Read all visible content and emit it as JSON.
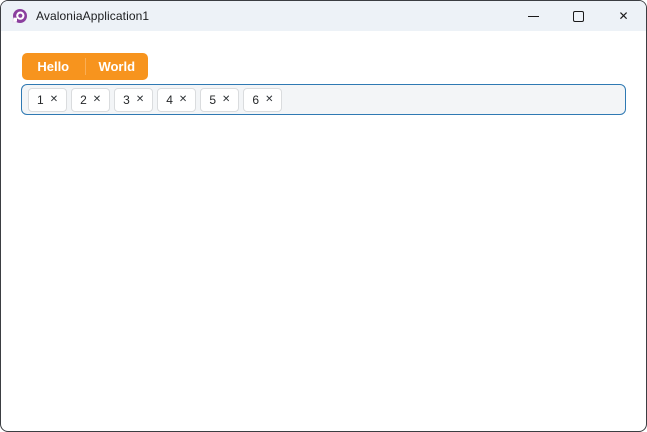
{
  "window": {
    "title": "AvaloniaApplication1",
    "controls": {
      "close_glyph": "✕"
    }
  },
  "tabs": {
    "items": [
      {
        "label": "Hello"
      },
      {
        "label": "World"
      }
    ]
  },
  "tags_input": {
    "items": [
      {
        "value": "1"
      },
      {
        "value": "2"
      },
      {
        "value": "3"
      },
      {
        "value": "4"
      },
      {
        "value": "5"
      },
      {
        "value": "6"
      }
    ],
    "remove_glyph": "✕"
  },
  "colors": {
    "accent_orange": "#F7941E",
    "tab_divider": "#FAAE55",
    "focus_border_blue": "#2F79B3",
    "titlebar_bg": "#EDF2F7",
    "tags_bg": "#F3F5F7",
    "logo_purple": "#8B3F9E",
    "window_border": "#3B3E42"
  }
}
